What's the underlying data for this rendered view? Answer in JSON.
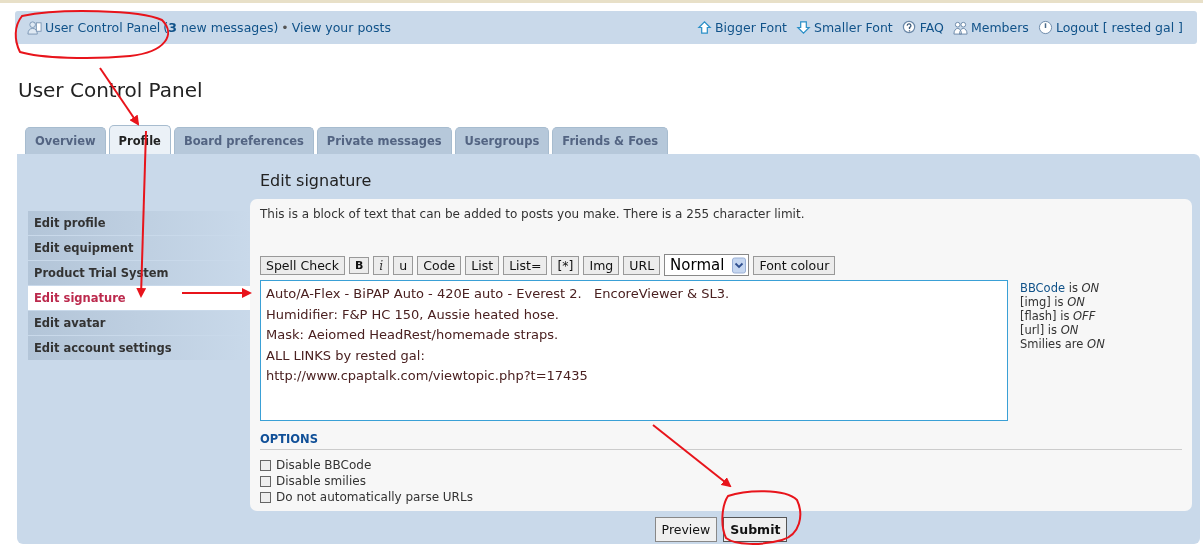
{
  "header": {
    "ucp_link": "User Control Panel",
    "messages": "(**3** new messages)",
    "separator": "•",
    "posts_link": "View your posts",
    "right_links": [
      {
        "kind": "bigger",
        "label": "Bigger Font"
      },
      {
        "kind": "smaller",
        "label": "Smaller Font"
      },
      {
        "kind": "faq",
        "label": "FAQ"
      },
      {
        "kind": "members",
        "label": "Members"
      },
      {
        "kind": "logout",
        "label": "Logout [ rested gal ]"
      }
    ]
  },
  "page_title": "User Control Panel",
  "tabs": [
    {
      "label": "Overview",
      "selected": false
    },
    {
      "label": "Profile",
      "selected": true
    },
    {
      "label": "Board preferences",
      "selected": false
    },
    {
      "label": "Private messages",
      "selected": false
    },
    {
      "label": "Usergroups",
      "selected": false
    },
    {
      "label": "Friends & Foes",
      "selected": false
    }
  ],
  "sidebar": {
    "items": [
      {
        "label": "Edit profile",
        "selected": false
      },
      {
        "label": "Edit equipment",
        "selected": false
      },
      {
        "label": "Product Trial System",
        "selected": false
      },
      {
        "label": "Edit signature",
        "selected": true
      },
      {
        "label": "Edit avatar",
        "selected": false
      },
      {
        "label": "Edit account settings",
        "selected": false
      }
    ]
  },
  "section_title": "Edit signature",
  "description": "This is a block of text that can be added to posts you make. There is a 255 character limit.",
  "toolbar": [
    {
      "kind": "button",
      "label": "Spell Check"
    },
    {
      "kind": "bold",
      "label": "B"
    },
    {
      "kind": "italic",
      "label": "i"
    },
    {
      "kind": "button",
      "label": "u"
    },
    {
      "kind": "button",
      "label": "Code"
    },
    {
      "kind": "button",
      "label": "List"
    },
    {
      "kind": "button",
      "label": "List="
    },
    {
      "kind": "button",
      "label": "[*]"
    },
    {
      "kind": "button",
      "label": "Img"
    },
    {
      "kind": "button",
      "label": "URL"
    },
    {
      "kind": "select",
      "label": "Normal"
    },
    {
      "kind": "button",
      "label": "Font colour"
    }
  ],
  "signature": "Auto/A-Flex - BiPAP Auto - 420E auto - Everest 2.   EncoreViewer & SL3.\nHumidifier: F&P HC 150, Aussie heated hose.\nMask: Aeiomed HeadRest/homemade straps.\nALL LINKS by rested gal:\nhttp://www.cpaptalk.com/viewtopic.php?t=17435",
  "status": [
    {
      "label": "BBCode",
      "link": true,
      "text": " is *ON*"
    },
    {
      "label": "[img]",
      "link": false,
      "text": " is *ON*"
    },
    {
      "label": "[flash]",
      "link": false,
      "text": " is *OFF*"
    },
    {
      "label": "[url]",
      "link": false,
      "text": " is *ON*"
    },
    {
      "label": "Smilies",
      "link": false,
      "text": " are *ON*"
    }
  ],
  "options_title": "OPTIONS",
  "options": [
    {
      "label": "Disable BBCode",
      "checked": false
    },
    {
      "label": "Disable smilies",
      "checked": false
    },
    {
      "label": "Do not automatically parse URLs",
      "checked": false
    }
  ],
  "buttons": [
    {
      "label": "Preview",
      "kind": "secondary"
    },
    {
      "label": "Submit",
      "kind": "primary"
    }
  ]
}
